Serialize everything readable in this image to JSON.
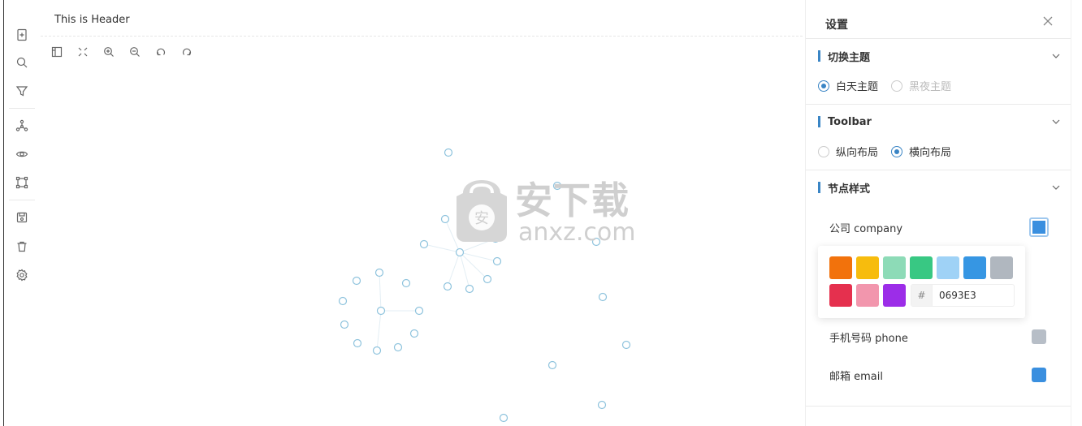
{
  "header": {
    "title": "This is Header"
  },
  "rail": {
    "items": [
      {
        "icon": "new-file-icon"
      },
      {
        "icon": "search-icon"
      },
      {
        "icon": "filter-icon"
      },
      {
        "icon": "graph-layout-icon"
      },
      {
        "icon": "eye-icon"
      },
      {
        "icon": "frame-select-icon"
      },
      {
        "icon": "save-icon"
      },
      {
        "icon": "trash-icon"
      },
      {
        "icon": "gear-icon"
      }
    ]
  },
  "toolbar": {
    "items": [
      {
        "icon": "panel-icon"
      },
      {
        "icon": "fit-view-icon"
      },
      {
        "icon": "zoom-in-icon"
      },
      {
        "icon": "zoom-out-icon"
      },
      {
        "icon": "undo-icon"
      },
      {
        "icon": "redo-icon"
      }
    ]
  },
  "watermark": {
    "cn": "安下载",
    "en": "anxz.com"
  },
  "settings": {
    "title": "设置",
    "theme": {
      "title": "切换主题",
      "options": [
        {
          "label": "白天主题",
          "selected": true
        },
        {
          "label": "黑夜主题",
          "selected": false
        }
      ]
    },
    "toolbar_section": {
      "title": "Toolbar",
      "options": [
        {
          "label": "纵向布局",
          "selected": false
        },
        {
          "label": "横向布局",
          "selected": true
        }
      ]
    },
    "node_style": {
      "title": "节点样式",
      "rows": [
        {
          "label": "公司 company",
          "color": "#3a8fdf"
        },
        {
          "label": "手机号码 phone",
          "color": "#b7bec7"
        },
        {
          "label": "邮箱 email",
          "color": "#3a8fdf"
        }
      ],
      "palette": [
        "#f2720c",
        "#f7bc0d",
        "#8ddbb7",
        "#38c883",
        "#9fd2f6",
        "#3696e3",
        "#b0b7bf",
        "#e5304e",
        "#f296ad",
        "#9c2de8"
      ],
      "hex_prefix": "#",
      "hex_value": "0693E3"
    }
  },
  "colors": {
    "accent": "#3a85c5",
    "node_stroke": "#8ec3dd"
  }
}
